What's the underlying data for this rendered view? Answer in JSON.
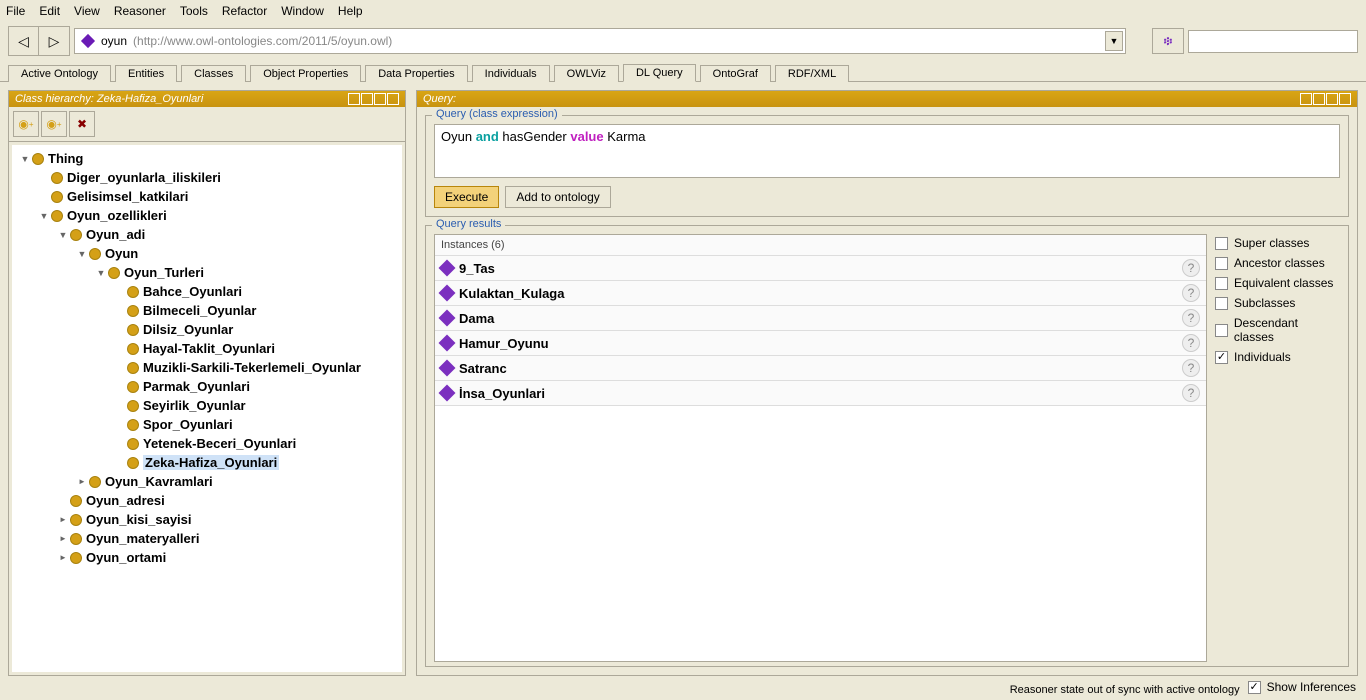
{
  "menu": [
    "File",
    "Edit",
    "View",
    "Reasoner",
    "Tools",
    "Refactor",
    "Window",
    "Help"
  ],
  "address": {
    "name": "oyun",
    "path": "(http://www.owl-ontologies.com/2011/5/oyun.owl)"
  },
  "tabs": [
    "Active Ontology",
    "Entities",
    "Classes",
    "Object Properties",
    "Data Properties",
    "Individuals",
    "OWLViz",
    "DL Query",
    "OntoGraf",
    "RDF/XML"
  ],
  "active_tab": "DL Query",
  "left_panel": {
    "title": "Class hierarchy: Zeka-Hafiza_Oyunlari"
  },
  "tree": {
    "root": "Thing",
    "n1": "Diger_oyunlarla_iliskileri",
    "n2": "Gelisimsel_katkilari",
    "n3": "Oyun_ozellikleri",
    "n31": "Oyun_adi",
    "n311": "Oyun",
    "n3111": "Oyun_Turleri",
    "leaves": [
      "Bahce_Oyunlari",
      "Bilmeceli_Oyunlar",
      "Dilsiz_Oyunlar",
      "Hayal-Taklit_Oyunlari",
      "Muzikli-Sarkili-Tekerlemeli_Oyunlar",
      "Parmak_Oyunlari",
      "Seyirlik_Oyunlar",
      "Spor_Oyunlari",
      "Yetenek-Beceri_Oyunlari",
      "Zeka-Hafiza_Oyunlari"
    ],
    "n312": "Oyun_Kavramlari",
    "n32": "Oyun_adresi",
    "n33": "Oyun_kisi_sayisi",
    "n34": "Oyun_materyalleri",
    "n35": "Oyun_ortami"
  },
  "right_panel": {
    "title": "Query:"
  },
  "query": {
    "section_label": "Query (class expression)",
    "text": {
      "p1": "Oyun ",
      "kw1": "and",
      "p2": " hasGender ",
      "kw2": "value",
      "p3": " Karma"
    },
    "btn_execute": "Execute",
    "btn_add": "Add to ontology"
  },
  "results": {
    "section_label": "Query results",
    "header": "Instances (6)",
    "items": [
      "9_Tas",
      "Kulaktan_Kulaga",
      "Dama",
      "Hamur_Oyunu",
      "Satranc",
      "İnsa_Oyunlari"
    ],
    "checks": [
      {
        "label": "Super classes",
        "checked": false
      },
      {
        "label": "Ancestor classes",
        "checked": false
      },
      {
        "label": "Equivalent classes",
        "checked": false
      },
      {
        "label": "Subclasses",
        "checked": false
      },
      {
        "label": "Descendant classes",
        "checked": false
      },
      {
        "label": "Individuals",
        "checked": true
      }
    ]
  },
  "status": {
    "msg": "Reasoner state out of sync with active ontology",
    "chk": "Show Inferences"
  }
}
